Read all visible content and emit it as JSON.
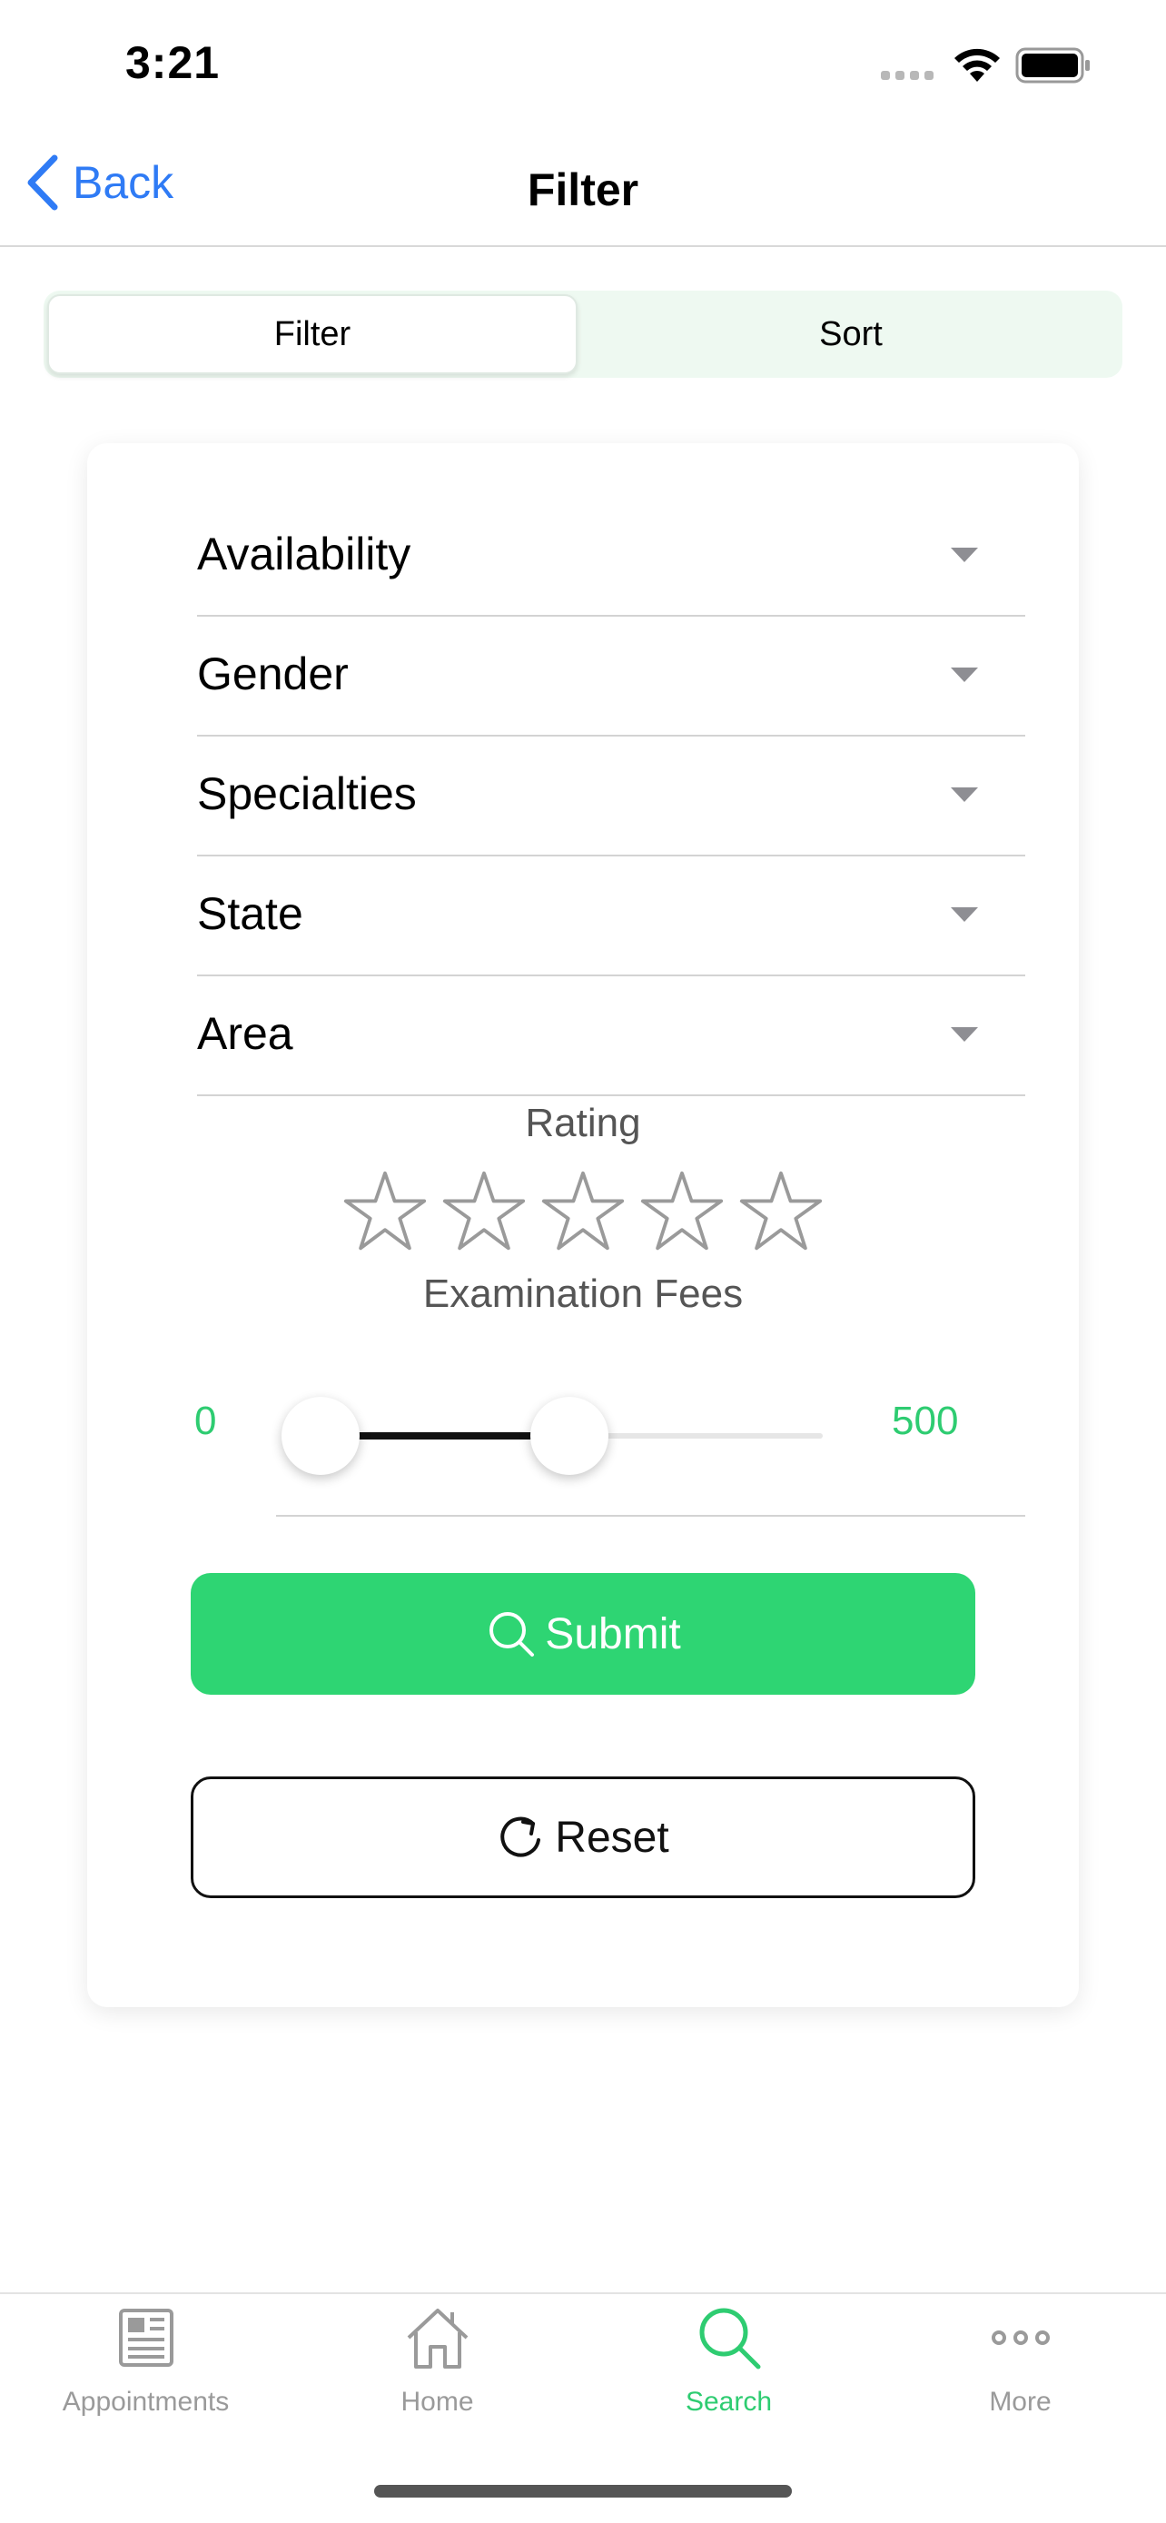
{
  "status_bar": {
    "time": "3:21"
  },
  "nav": {
    "back_label": "Back",
    "title": "Filter"
  },
  "segmented": {
    "options": [
      "Filter",
      "Sort"
    ],
    "selected": "Filter"
  },
  "filters": [
    {
      "label": "Availability"
    },
    {
      "label": "Gender"
    },
    {
      "label": "Specialties"
    },
    {
      "label": "State"
    },
    {
      "label": "Area"
    }
  ],
  "rating": {
    "label": "Rating",
    "max_stars": 5,
    "selected": 0
  },
  "fees": {
    "label": "Examination Fees",
    "min_label": "0",
    "max_label": "500",
    "range_min": 0,
    "range_max": 500,
    "low_fraction": 0.0,
    "high_fraction": 0.5
  },
  "buttons": {
    "submit": "Submit",
    "reset": "Reset"
  },
  "tabbar": {
    "items": [
      {
        "label": "Appointments",
        "icon": "newspaper-icon"
      },
      {
        "label": "Home",
        "icon": "home-icon"
      },
      {
        "label": "Search",
        "icon": "search-icon",
        "active": true
      },
      {
        "label": "More",
        "icon": "more-icon"
      }
    ]
  },
  "colors": {
    "accent": "#2ed573",
    "link": "#2f7bf5",
    "segment_bg": "#eef9f1"
  }
}
